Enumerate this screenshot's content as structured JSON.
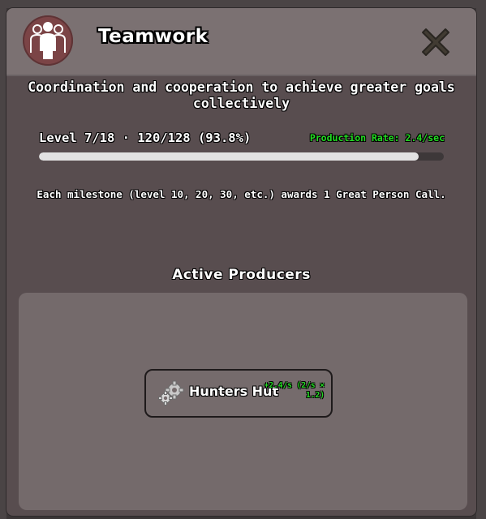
{
  "dialog": {
    "title": "Teamwork",
    "icon": "teamwork-people-icon",
    "close_icon": "close-icon",
    "description": "Coordination and cooperation to achieve greater goals collectively"
  },
  "progress": {
    "level_text": "Level 7/18 · 120/128 (93.8%)",
    "percent": 93.8,
    "production_rate": "Production Rate: 2.4/sec"
  },
  "milestone_text": "Each milestone (level 10, 20, 30, etc.) awards 1 Great Person Call.",
  "producers": {
    "title": "Active Producers",
    "items": [
      {
        "name": "Hunters Hut",
        "rate": "+2.4/s (2/s × 1.2)",
        "icon": "gears-icon"
      }
    ]
  },
  "colors": {
    "accent_green": "#22dd22",
    "icon_circle": "#7b4446",
    "panel": "#584d4f",
    "header": "#7b7172"
  }
}
